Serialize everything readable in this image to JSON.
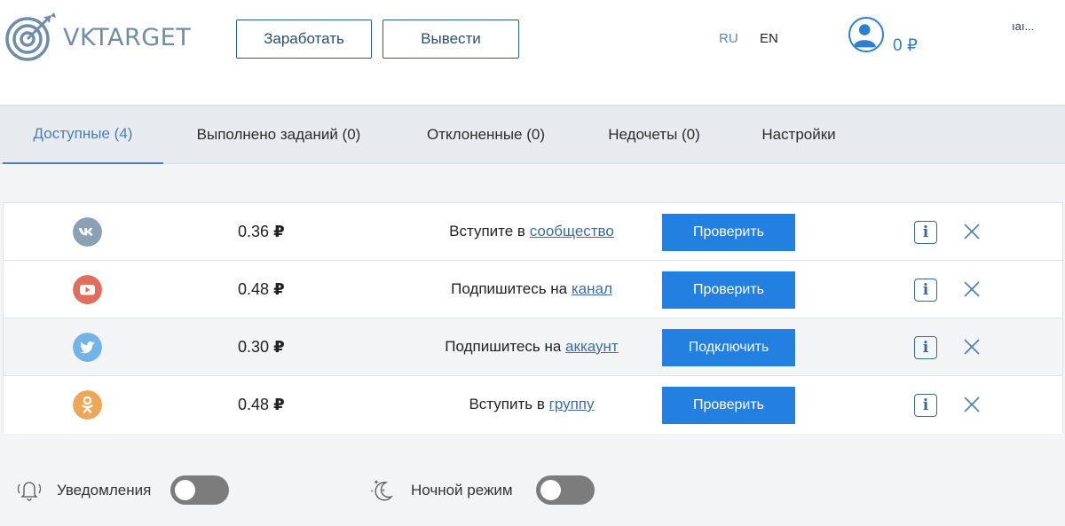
{
  "header": {
    "logo_text": "VKTARGET",
    "earn_label": "Заработать",
    "withdraw_label": "Вывести",
    "lang_ru": "RU",
    "lang_en": "EN",
    "username": "ıaı...",
    "balance": "0 ₽"
  },
  "tabs": [
    {
      "label": "Доступные (4)",
      "active": true
    },
    {
      "label": "Выполнено заданий (0)",
      "active": false
    },
    {
      "label": "Отклоненные (0)",
      "active": false
    },
    {
      "label": "Недочеты (0)",
      "active": false
    },
    {
      "label": "Настройки",
      "active": false
    }
  ],
  "tasks": [
    {
      "network": "vk",
      "icon": "vk-icon",
      "color": "#8b9fb5",
      "price": "0.36",
      "currency": "₽",
      "text": "Вступите в",
      "link": "сообщество",
      "action": "Проверить"
    },
    {
      "network": "youtube",
      "icon": "youtube-icon",
      "color": "#df6f5a",
      "price": "0.48",
      "currency": "₽",
      "text": "Подпишитесь на",
      "link": "канал",
      "action": "Проверить"
    },
    {
      "network": "twitter",
      "icon": "twitter-icon",
      "color": "#74b3e6",
      "price": "0.30",
      "currency": "₽",
      "text": "Подпишитесь на",
      "link": "аккаунт",
      "action": "Подключить"
    },
    {
      "network": "odnoklassniki",
      "icon": "odnoklassniki-icon",
      "color": "#eea659",
      "price": "0.48",
      "currency": "₽",
      "text": "Вступить в",
      "link": "группу",
      "action": "Проверить"
    }
  ],
  "info_symbol": "i",
  "options": {
    "notifications_label": "Уведомления",
    "notifications_on": false,
    "night_mode_label": "Ночной режим",
    "night_mode_on": false
  },
  "colors": {
    "accent": "#2380e0",
    "link": "#3d6d9e",
    "tab_active": "#4a7fb1"
  }
}
